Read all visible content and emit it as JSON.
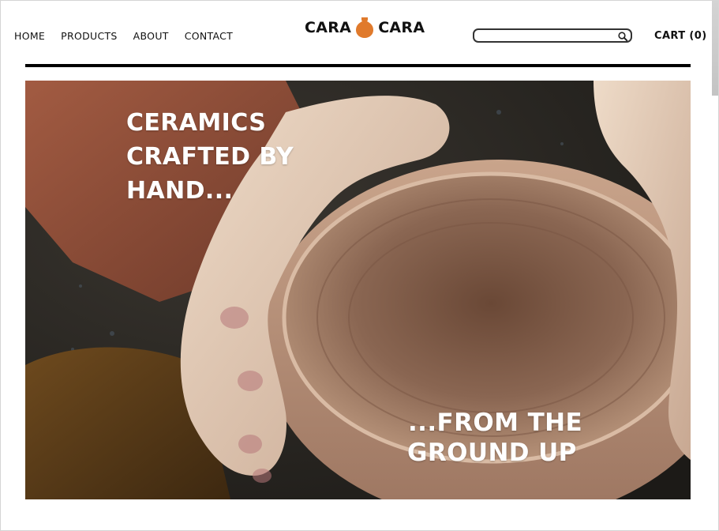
{
  "nav": {
    "items": [
      {
        "label": "HOME"
      },
      {
        "label": "PRODUCTS"
      },
      {
        "label": "ABOUT"
      },
      {
        "label": "CONTACT"
      }
    ]
  },
  "logo": {
    "left_word": "CARA",
    "right_word": "CARA",
    "icon": "vase-icon",
    "accent": "#e07a2c"
  },
  "search": {
    "value": "",
    "placeholder": "",
    "icon": "search-icon"
  },
  "cart": {
    "label": "CART (0)"
  },
  "hero": {
    "headline_lines": [
      "CERAMICS",
      "CRAFTED BY",
      "HAND..."
    ],
    "tagline_lines": [
      "...FROM THE",
      "GROUND UP"
    ]
  },
  "colors": {
    "text": "#111111",
    "divider": "#000000",
    "hero_text": "#ffffff"
  }
}
